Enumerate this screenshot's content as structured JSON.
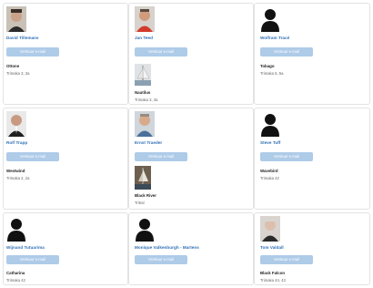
{
  "button_label": "Verstuur e-mail",
  "icons": {
    "silhouette": "person-silhouette-icon",
    "photo": "profile-photo"
  },
  "members": [
    {
      "name": "David Tillemans",
      "boat": "Ottone",
      "sub": "Trimaka 3, 3a",
      "photo": "photo"
    },
    {
      "name": "Jan Teed",
      "boat": "Nautilus",
      "sub": "Trimaka 3, 3a",
      "photo": "photo",
      "has_boat_image": true
    },
    {
      "name": "Wolfram Tracé",
      "boat": "Tobago",
      "sub": "Trimaka 5, 5a",
      "photo": "silhouette"
    },
    {
      "name": "Rolf Trapp",
      "boat": "Westwind",
      "sub": "Trimaka 2, 2a",
      "photo": "photo"
    },
    {
      "name": "Ernst Traeder",
      "boat": "Black River",
      "sub": "Tritral",
      "photo": "photo",
      "has_boat_image": true
    },
    {
      "name": "Steve Tuff",
      "boat": "Wavebird",
      "sub": "Trimaka 42",
      "photo": "silhouette"
    },
    {
      "name": "Wijnand Tutuarima",
      "boat": "Catharina",
      "sub": "Trimaka 42",
      "photo": "silhouette"
    },
    {
      "name": "Monique Valkenburgh - Martens",
      "boat": "",
      "sub": "",
      "photo": "silhouette"
    },
    {
      "name": "Tom Valdall",
      "boat": "Black Falcon",
      "sub": "Trimaka 44, 43",
      "photo": "photo"
    }
  ]
}
